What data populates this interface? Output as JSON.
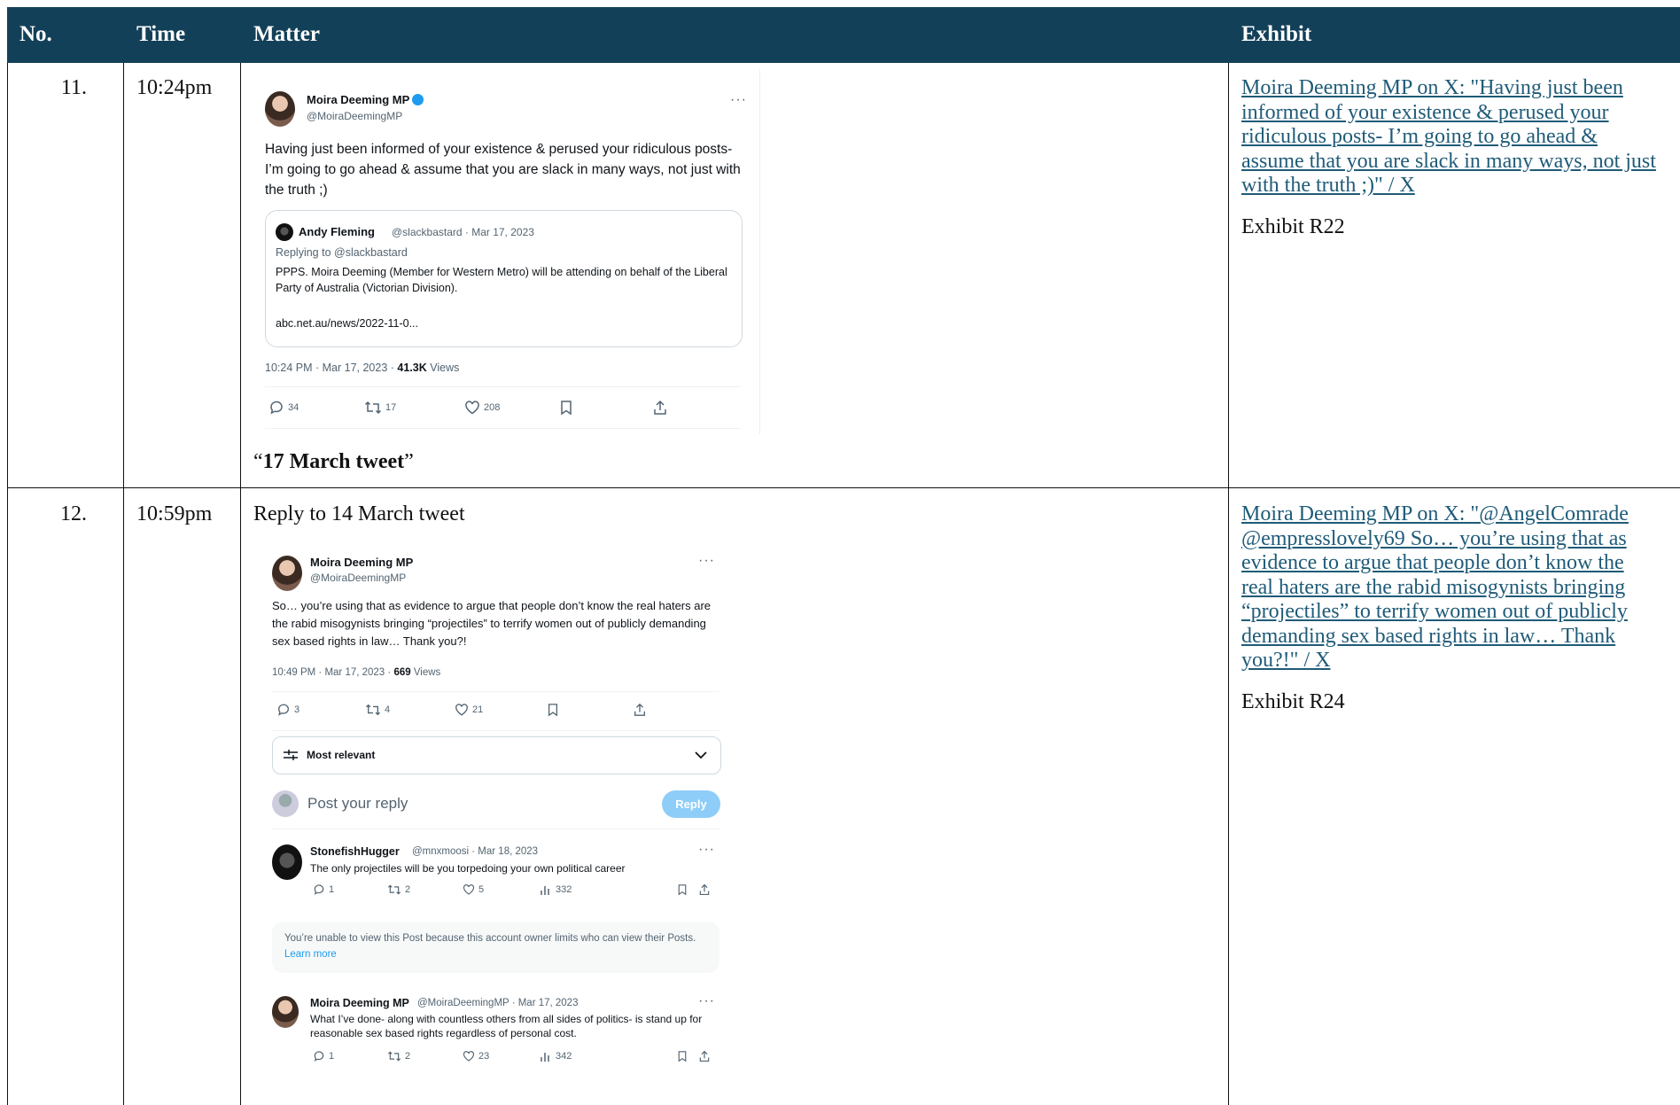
{
  "table": {
    "headers": {
      "no": "No.",
      "time": "Time",
      "matter": "Matter",
      "exhibit": "Exhibit"
    },
    "rows": [
      {
        "no": "11.",
        "time": "10:24pm",
        "caption_open": "“",
        "caption_bold": "17 March tweet",
        "caption_close": "”",
        "exhibit_link": "Moira Deeming MP on X: \"Having just been informed of your existence & perused your ridiculous posts- I’m going to go ahead & assume that you are slack in many ways, not just with the truth ;)\" / X",
        "exhibit_label": "Exhibit R22"
      },
      {
        "no": "12.",
        "time": "10:59pm",
        "intro": "Reply to 14 March tweet",
        "exhibit_link": "Moira Deeming MP on X: \"@AngelComrade @empresslovely69 So… you’re using that as evidence to argue that people don’t know the real haters are the rabid misogynists bringing “projectiles” to terrify women out of publicly demanding sex based rights in law… Thank you?!\" / X",
        "exhibit_label": "Exhibit R24"
      }
    ]
  },
  "tweet1": {
    "name": "Moira Deeming MP",
    "handle": "@MoiraDeemingMP",
    "more": "···",
    "text": "Having just been informed of your existence & perused your ridiculous posts- I’m going to go ahead & assume that you are slack in many ways, not just with the truth ;)",
    "quote": {
      "name": "Andy Fleming",
      "handle_date": "@slackbastard · Mar 17, 2023",
      "replying": "Replying to @slackbastard",
      "text": "PPPS. Moira Deeming (Member for Western Metro) will be attending on behalf of the Liberal Party of Australia (Victorian Division).",
      "link": "abc.net.au/news/2022-11-0..."
    },
    "timestamp": "10:24 PM · Mar 17, 2023 · ",
    "views_count": "41.3K",
    "views_label": " Views",
    "replies": "34",
    "retweets": "17",
    "likes": "208"
  },
  "tweet2": {
    "name": "Moira Deeming MP",
    "handle": "@MoiraDeemingMP",
    "more": "···",
    "text": "So… you’re using that as evidence to argue that people don’t know the real haters are the rabid misogynists bringing “projectiles” to terrify women out of publicly demanding sex based rights in law… Thank you?!",
    "timestamp": "10:49 PM · Mar 17, 2023 · ",
    "views_count": "669",
    "views_label": " Views",
    "replies": "3",
    "retweets": "4",
    "likes": "21",
    "sort_label": "Most relevant",
    "reply_placeholder": "Post your reply",
    "reply_button": "Reply",
    "reply1": {
      "name": "StonefishHugger",
      "handle_date": "@mnxmoosi · Mar 18, 2023",
      "text": "The only projectiles will be you torpedoing your own political career",
      "replies": "1",
      "retweets": "2",
      "likes": "5",
      "views": "332"
    },
    "restricted": "You’re unable to view this Post because this account owner limits who can view their Posts.",
    "learn_more": "Learn more",
    "reply2": {
      "name": "Moira Deeming MP",
      "handle_date": "@MoiraDeemingMP · Mar 17, 2023",
      "text": "What I’ve done- along with countless others from all sides of politics- is stand up for reasonable sex based rights regardless of personal cost.",
      "replies": "1",
      "retweets": "2",
      "likes": "23",
      "views": "342"
    }
  },
  "colors": {
    "header_bg": "#134059",
    "link": "#1f5b78",
    "twitter_blue": "#1d9bf0"
  }
}
